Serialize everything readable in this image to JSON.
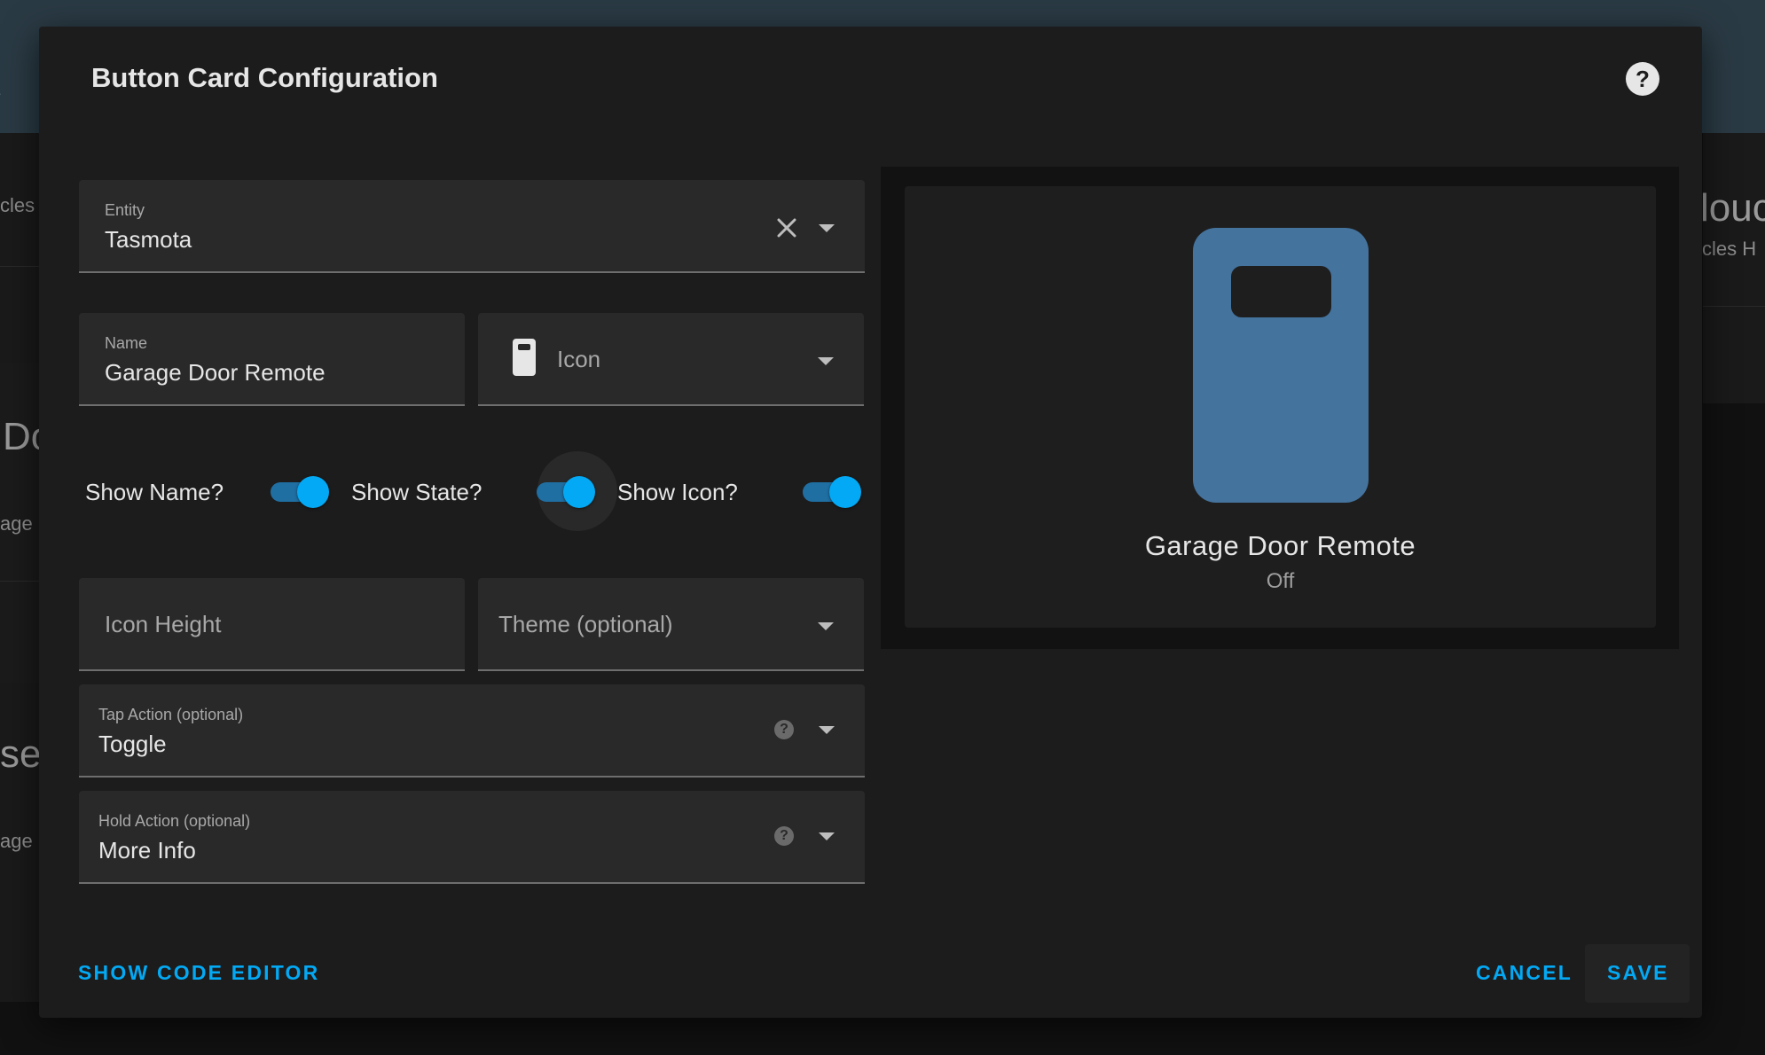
{
  "background": {
    "left_items": [
      "cles",
      "Do",
      "age",
      "ser",
      "age"
    ],
    "right_items": [
      "louc",
      "cles H"
    ]
  },
  "dialog": {
    "title": "Button Card Configuration",
    "help_icon": "help-circle-icon"
  },
  "entity": {
    "label": "Entity",
    "value": "Tasmota",
    "clear_icon": "close-icon",
    "dropdown_icon": "caret-down-icon"
  },
  "name_field": {
    "label": "Name",
    "value": "Garage Door Remote"
  },
  "icon_field": {
    "value": "Icon",
    "icon": "remote-icon"
  },
  "toggles": {
    "show_name": {
      "label": "Show Name?",
      "on": true
    },
    "show_state": {
      "label": "Show State?",
      "on": true
    },
    "show_icon": {
      "label": "Show Icon?",
      "on": true
    }
  },
  "icon_height": {
    "placeholder": "Icon Height"
  },
  "theme": {
    "placeholder": "Theme (optional)"
  },
  "tap_action": {
    "label": "Tap Action (optional)",
    "value": "Toggle"
  },
  "hold_action": {
    "label": "Hold Action (optional)",
    "value": "More Info"
  },
  "preview": {
    "name": "Garage Door Remote",
    "state": "Off",
    "icon": "remote-icon",
    "icon_color": "#44739e"
  },
  "footer": {
    "show_code_editor": "SHOW CODE EDITOR",
    "cancel": "CANCEL",
    "save": "SAVE"
  },
  "colors": {
    "accent": "#03a9f4",
    "dialog_bg": "#1c1c1c",
    "field_bg": "#292929"
  }
}
